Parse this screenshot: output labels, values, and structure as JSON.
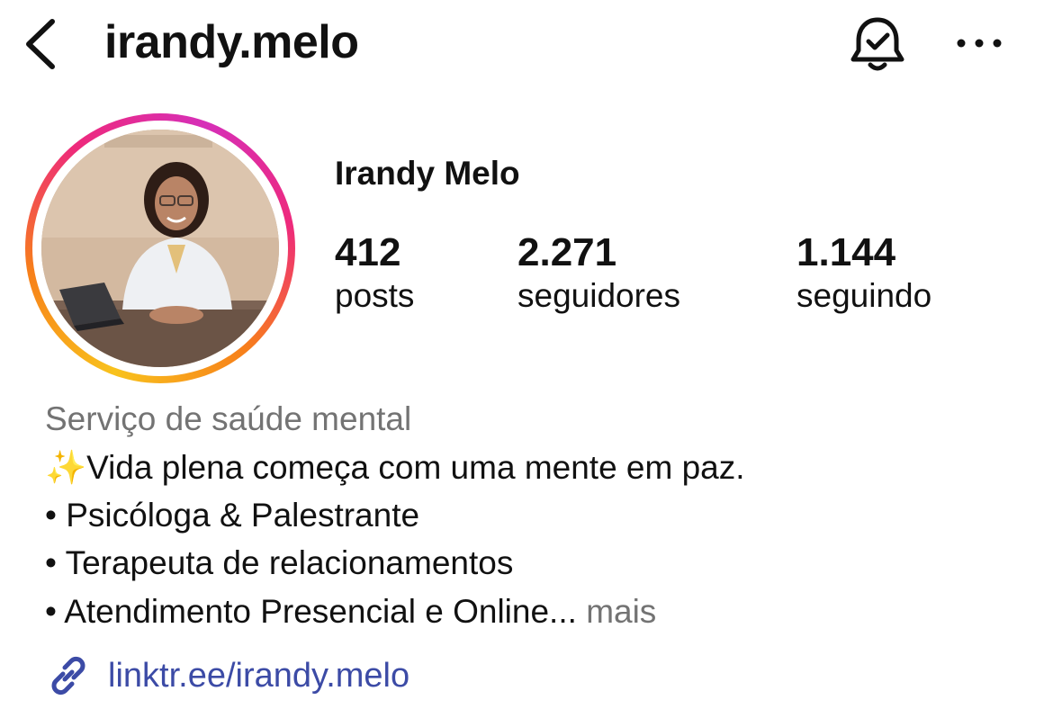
{
  "header": {
    "username": "irandy.melo",
    "icons": {
      "back": "chevron-left-icon",
      "notifications": "bell-check-icon",
      "more": "ellipsis-icon"
    }
  },
  "profile": {
    "display_name": "Irandy Melo",
    "stats": [
      {
        "value": "412",
        "label": "posts"
      },
      {
        "value": "2.271",
        "label": "seguidores"
      },
      {
        "value": "1.144",
        "label": "seguindo"
      }
    ],
    "category": "Serviço de saúde mental",
    "bio": [
      "✨Vida plena começa com uma mente em paz.",
      "• Psicóloga & Palestrante",
      "• Terapeuta de relacionamentos",
      "• Atendimento Presencial e Online... "
    ],
    "bio_more": "mais",
    "link": "linktr.ee/irandy.melo"
  },
  "colors": {
    "link": "#3c4ba6",
    "secondary_text": "#737373",
    "story_ring": [
      "#f8c21d",
      "#f77f1a",
      "#ee2a7b",
      "#d62fb8"
    ]
  }
}
